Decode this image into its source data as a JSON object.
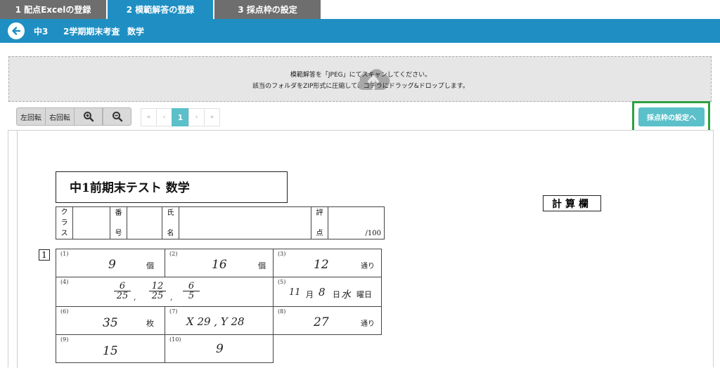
{
  "steps": [
    {
      "label": "1  配点Excelの登録"
    },
    {
      "label": "2  模範解答の登録"
    },
    {
      "label": "3 採点枠の設定"
    }
  ],
  "header": {
    "grade": "中3",
    "exam": "2学期期末考査",
    "subject": "数学"
  },
  "dropzone": {
    "line1": "模範解答を「JPEG」にてスキャンしてください。",
    "line2": "該当のフォルダをZIP形式に圧縮して、コチラにドラッグ&ドロップします。",
    "icon": "cloud-upload-icon"
  },
  "toolbar": {
    "rotate_left": "左回転",
    "rotate_right": "右回転",
    "zoom_in_icon": "zoom-in-icon",
    "zoom_out_icon": "zoom-out-icon"
  },
  "pager": {
    "first": "«",
    "prev": "‹",
    "current": "1",
    "next": "›",
    "last": "»"
  },
  "next_button": "採点枠の設定へ",
  "colors": {
    "primary_blue": "#1f8fc3",
    "tab_gray": "#6e6e6e",
    "teal": "#5bc0c9",
    "highlight_green": "#2ea043"
  },
  "sheet": {
    "title": "中1前期末テスト  数学",
    "labels": {
      "class": [
        "ク",
        "ラ",
        "ス"
      ],
      "number": [
        "番",
        "号"
      ],
      "name": [
        "氏",
        "名"
      ],
      "score": [
        "評",
        "点"
      ],
      "max": "/100"
    },
    "calc_label": "計算欄",
    "question_number": "1",
    "answers": {
      "q1": {
        "num": "(1)",
        "value": "9",
        "unit": "個"
      },
      "q2": {
        "num": "(2)",
        "value": "16",
        "unit": "個"
      },
      "q3": {
        "num": "(3)",
        "value": "12",
        "unit": "通り"
      },
      "q4": {
        "num": "(4)",
        "fracs": [
          {
            "n": "6",
            "d": "25"
          },
          {
            "n": "12",
            "d": "25"
          },
          {
            "n": "6",
            "d": "5"
          }
        ],
        "sep": ","
      },
      "q5": {
        "num": "(5)",
        "month": "11",
        "month_unit": "月",
        "day": "8",
        "day_unit": "日",
        "weekday": "水",
        "weekday_unit": "曜日"
      },
      "q6": {
        "num": "(6)",
        "value": "35",
        "unit": "枚"
      },
      "q7": {
        "num": "(7)",
        "value": "X 29 , Y 28"
      },
      "q8": {
        "num": "(8)",
        "value": "27",
        "unit": "通り"
      },
      "q9": {
        "num": "(9)",
        "value": "15"
      },
      "q10": {
        "num": "(10)",
        "value": "9"
      }
    }
  }
}
